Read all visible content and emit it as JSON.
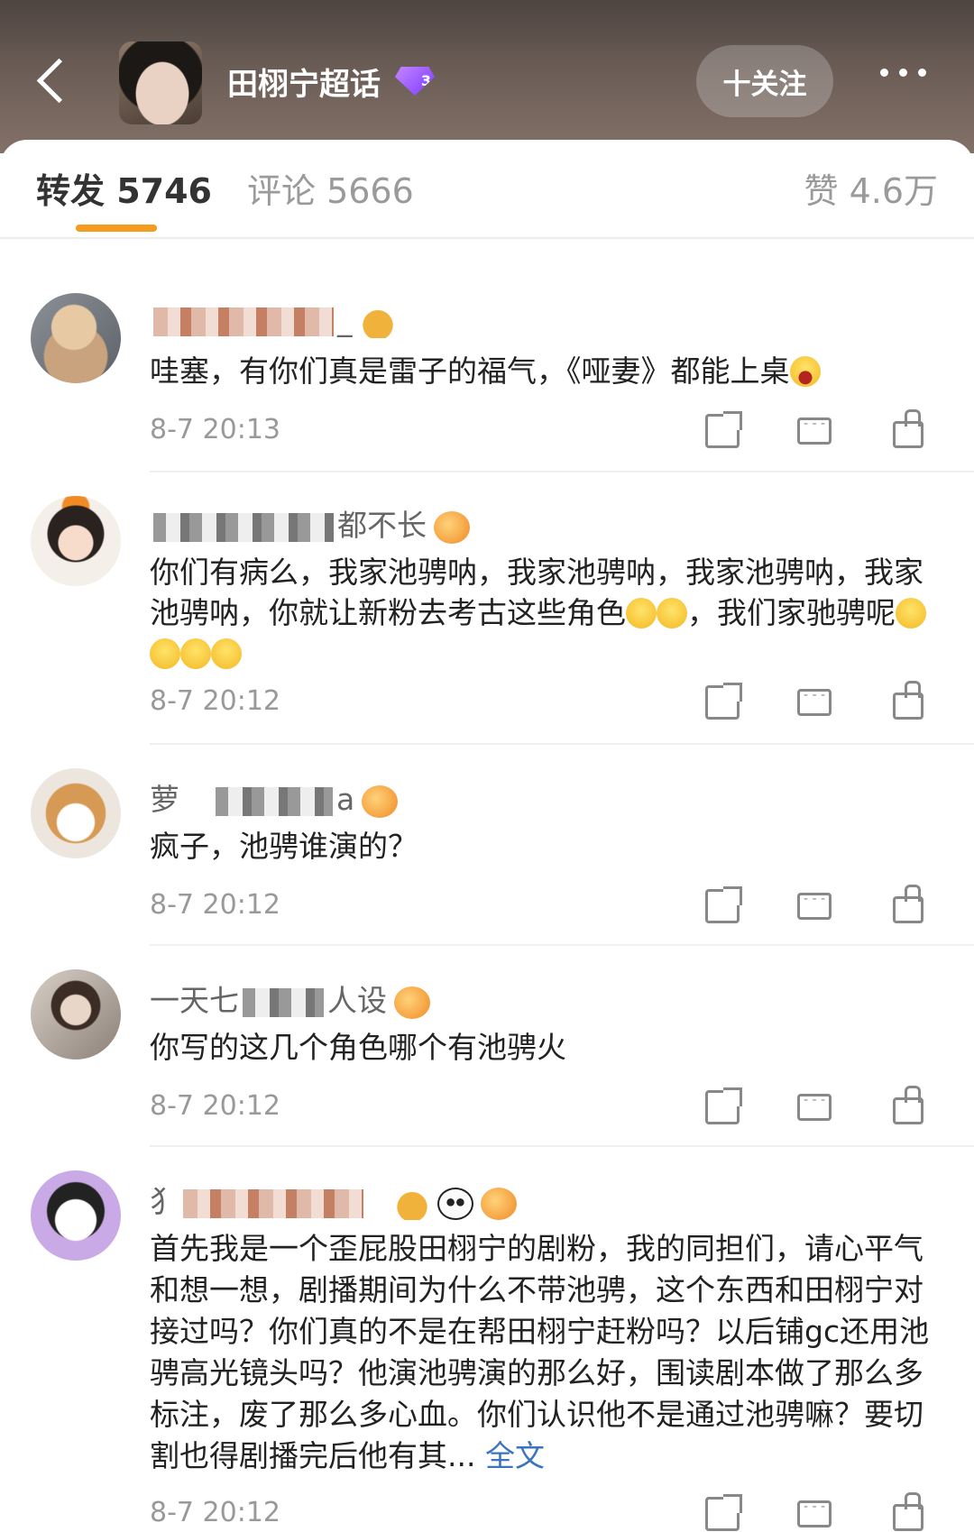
{
  "header": {
    "group_title": "田栩宁超话",
    "level_badge": "3",
    "follow_label": "十关注"
  },
  "tabs": {
    "repost": "转发 5746",
    "comment": "评论 5666",
    "like": "赞 4.6万"
  },
  "comments": [
    {
      "username_visible": "_",
      "text": "哇塞，有你们真是雷子的福气，《哑妻》都能上桌",
      "time": "8-7 20:13"
    },
    {
      "username_prefix": "",
      "username_suffix": "都不长",
      "text": "你们有病么，我家池骋呐，我家池骋呐，我家池骋呐，我家池骋呐，你就让新粉去考古这些角色",
      "text_tail": "，我们家驰骋呢",
      "time": "8-7 20:12"
    },
    {
      "username_prefix": "萝",
      "username_suffix": "a",
      "text": "疯子，池骋谁演的？",
      "time": "8-7 20:12"
    },
    {
      "username_prefix": "一天七",
      "username_suffix": "人设",
      "text": "你写的这几个角色哪个有池骋火",
      "time": "8-7 20:12"
    },
    {
      "username_prefix": "犭",
      "text": "首先我是一个歪屁股田栩宁的剧粉，我的同担们，请心平气和想一想，剧播期间为什么不带池骋，这个东西和田栩宁对接过吗？你们真的不是在帮田栩宁赶粉吗？以后铺gc还用池骋高光镜头吗？他演池骋演的那么好，围读剧本做了那么多标注，废了那么多心血。你们认识他不是通过池骋嘛？要切割也得剧播完后他有其...",
      "more_link": "全文",
      "time": "8-7 20:12"
    }
  ]
}
